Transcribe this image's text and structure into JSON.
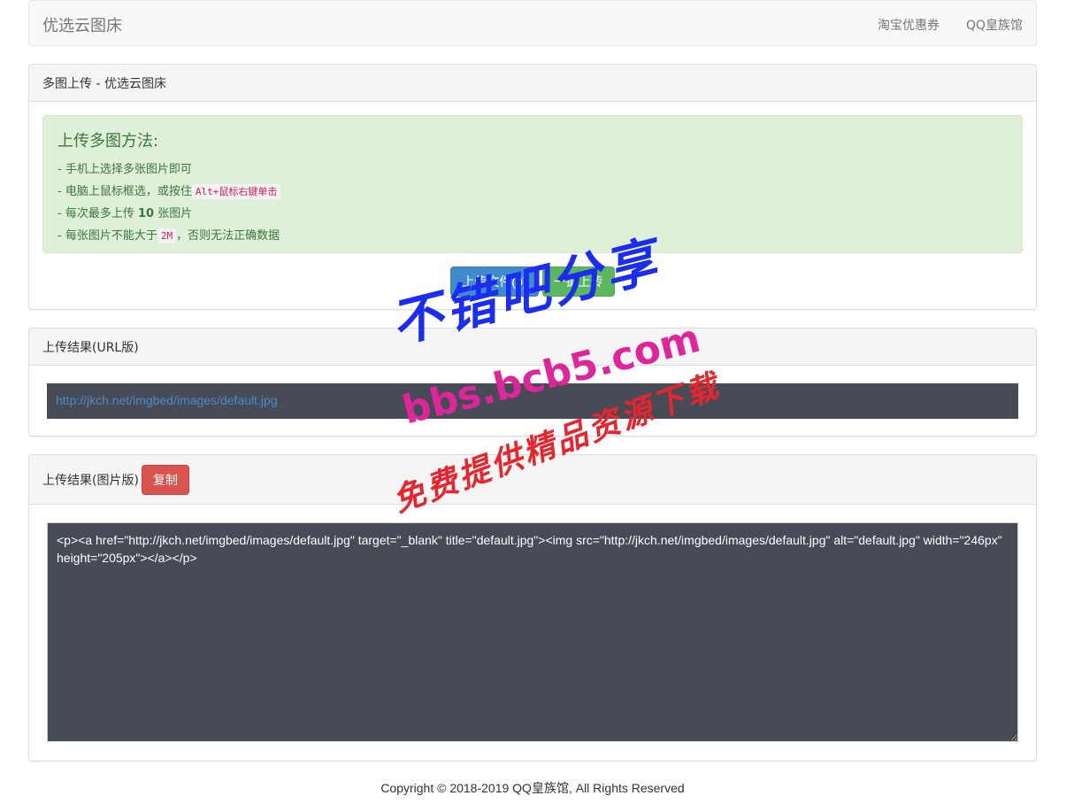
{
  "navbar": {
    "brand": "优选云图床",
    "links": [
      "淘宝优惠券",
      "QQ皇族馆"
    ]
  },
  "upload_panel": {
    "heading": "多图上传 - 优选云图床",
    "tips_title": "上传多图方法:",
    "tip1": "- 手机上选择多张图片即可",
    "tip2_prefix": "- 电脑上鼠标框选，或按住",
    "tip2_code": "Alt+鼠标右键单击",
    "tip3_prefix": "- 每次最多上传 ",
    "tip3_bold": "10",
    "tip3_suffix": " 张图片",
    "tip4_prefix": "- 每张图片不能大于",
    "tip4_code": "2M",
    "tip4_suffix": "，否则无法正确数据",
    "upload_file_button": "上传文件(0)",
    "one_click_upload_button": "一键上传"
  },
  "url_panel": {
    "heading": "上传结果(URL版)",
    "url": "http://jkch.net/imgbed/images/default.jpg"
  },
  "image_panel": {
    "heading": "上传结果(图片版)",
    "copy_button": "复制",
    "code": "<p><a href=\"http://jkch.net/imgbed/images/default.jpg\" target=\"_blank\" title=\"default.jpg\"><img src=\"http://jkch.net/imgbed/images/default.jpg\" alt=\"default.jpg\" width=\"246px\" height=\"205px\"></a></p>"
  },
  "footer": {
    "prefix": "Copyright © 2018-2019 ",
    "link": "QQ皇族馆",
    "suffix": ", All Rights Reserved"
  },
  "watermark": {
    "line1": "不错吧分享",
    "line2": "bbs.bcb5.com",
    "line3": "免费提供精品资源下载"
  },
  "colors": {
    "primary": "#428bca",
    "success": "#5cb85c",
    "danger": "#d9534f",
    "alert_bg": "#dff0d8",
    "code_bg": "#464b56"
  }
}
